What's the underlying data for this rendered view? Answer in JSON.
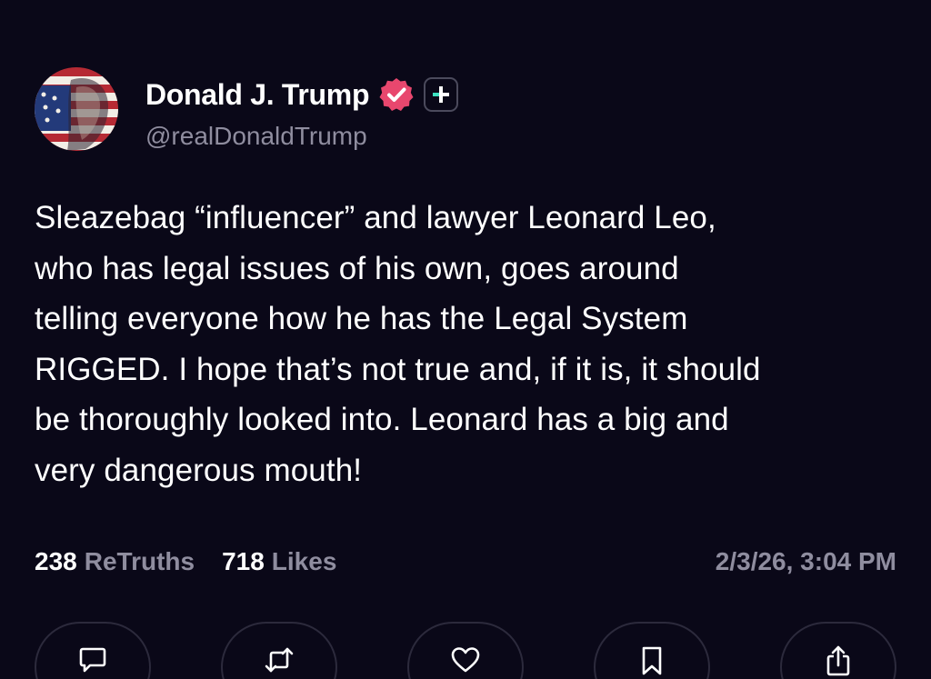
{
  "author": {
    "display_name": "Donald J. Trump",
    "handle": "@realDonaldTrump",
    "avatar_icon": "avatar-flag-portrait",
    "verified_icon": "verified-badge-icon",
    "plus_icon": "plus-badge-icon"
  },
  "post": {
    "lines": [
      "Sleazebag “influencer” and lawyer Leonard Leo,",
      "who has legal issues of his own, goes around",
      "telling everyone how he has the Legal System",
      "RIGGED. I hope that’s not true and, if it is, it should",
      "be thoroughly looked into. Leonard has a big and",
      "very dangerous mouth!"
    ]
  },
  "stats": {
    "retruths_count": "238",
    "retruths_label": "ReTruths",
    "likes_count": "718",
    "likes_label": "Likes",
    "timestamp": "2/3/26, 3:04 PM"
  },
  "actions": [
    {
      "name": "reply-button",
      "icon": "comment-icon"
    },
    {
      "name": "retruth-button",
      "icon": "retruth-icon"
    },
    {
      "name": "like-button",
      "icon": "heart-icon"
    },
    {
      "name": "bookmark-button",
      "icon": "bookmark-icon"
    },
    {
      "name": "share-button",
      "icon": "share-icon"
    }
  ],
  "colors": {
    "background": "#0a0818",
    "verified": "#e8476e",
    "muted_text": "#8f8d9f",
    "plus_accent": "#3ce0c0"
  }
}
